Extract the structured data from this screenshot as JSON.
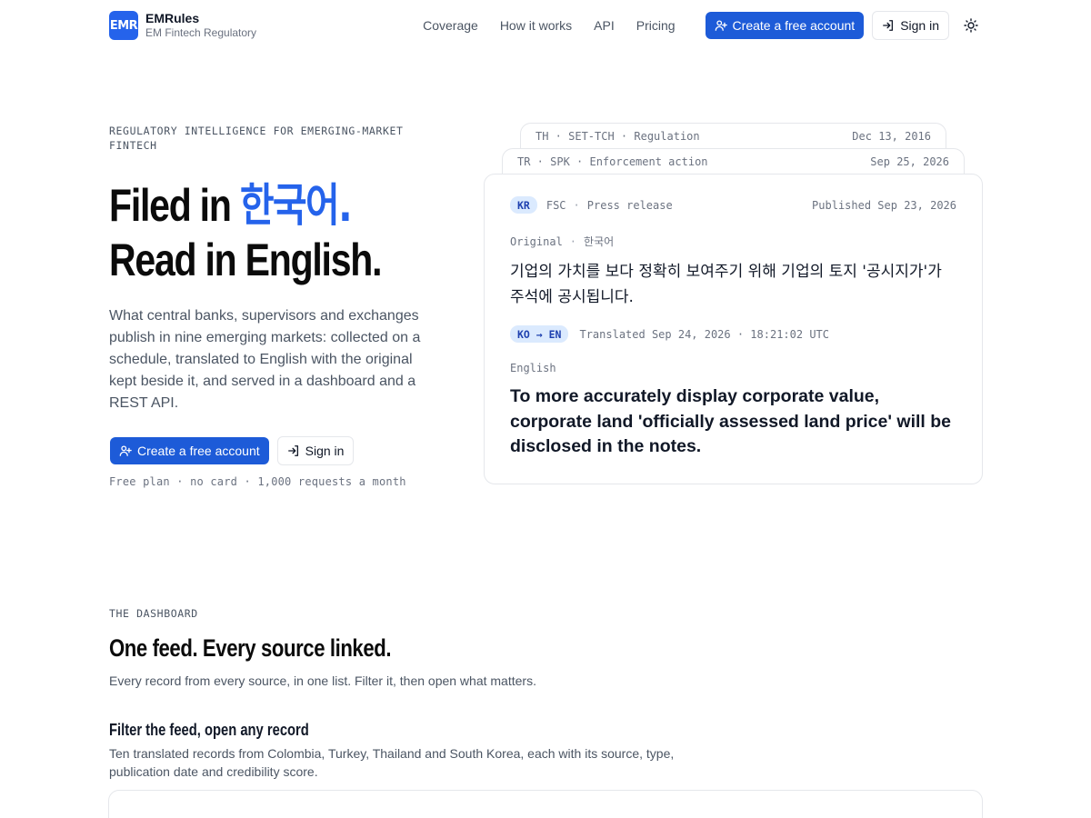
{
  "header": {
    "logo_text": "EMR",
    "brand_name": "EMRules",
    "brand_sub": "EM Fintech Regulatory",
    "nav": [
      "Coverage",
      "How it works",
      "API",
      "Pricing"
    ],
    "create_label": "Create a free account",
    "signin_label": "Sign in",
    "theme_icon": "sun-icon"
  },
  "hero": {
    "eyebrow": "REGULATORY INTELLIGENCE FOR EMERGING-MARKET FINTECH",
    "title_line1_prefix": "Filed in ",
    "title_line1_accent": "한국어.",
    "title_line2": "Read in English.",
    "description": "What central banks, supervisors and exchanges publish in nine emerging markets: collected on a schedule, translated to English with the original kept beside it, and served in a dashboard and a REST API.",
    "create_label": "Create a free account",
    "signin_label": "Sign in",
    "note": "Free plan · no card · 1,000 requests a month"
  },
  "cards": {
    "back1": {
      "meta": "TH · SET-TCH · Regulation",
      "date": "Dec 13, 2016"
    },
    "back2": {
      "meta": "TR · SPK · Enforcement action",
      "date": "Sep 25, 2026"
    },
    "main": {
      "country": "KR",
      "source": "FSC",
      "type": "Press release",
      "published": "Published Sep 23, 2026",
      "original_label": "Original",
      "original_lang": "한국어",
      "original_text": "기업의 가치를 보다 정확히 보여주기 위해 기업의 토지 '공시지가'가 주석에 공시됩니다.",
      "translation_badge": "KO → EN",
      "translated": "Translated Sep 24, 2026 · 18:21:02 UTC",
      "english_label": "English",
      "english_text": "To more accurately display corporate value, corporate land 'officially assessed land price' will be disclosed in the notes."
    }
  },
  "dashboard": {
    "eyebrow": "THE DASHBOARD",
    "title": "One feed. Every source linked.",
    "description": "Every record from every source, in one list. Filter it, then open what matters.",
    "sub_title": "Filter the feed, open any record",
    "sub_description": "Ten translated records from Colombia, Turkey, Thailand and South Korea, each with its source, type, publication date and credibility score."
  },
  "colors": {
    "accent": "#2563eb",
    "primary_button": "#1d5bd8"
  }
}
